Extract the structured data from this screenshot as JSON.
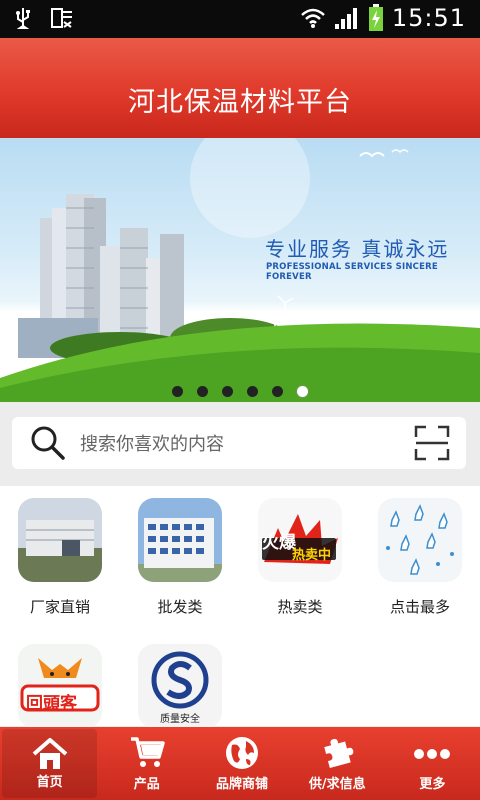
{
  "status": {
    "time": "15:51"
  },
  "header": {
    "title": "河北保温材料平台"
  },
  "banner": {
    "slogan": "专业服务  真诚永远",
    "slogan_en": "PROFESSIONAL SERVICES SINCERE FOREVER",
    "slides": 6,
    "active_slide": 6
  },
  "search": {
    "placeholder": "搜索你喜欢的内容"
  },
  "grid": {
    "items": [
      {
        "label": "厂家直销",
        "icon": "factory-image"
      },
      {
        "label": "批发类",
        "icon": "building-image"
      },
      {
        "label": "热卖类",
        "icon": "hot-sale-image",
        "badge_line1": "火爆",
        "badge_line2": "热卖中"
      },
      {
        "label": "点击最多",
        "icon": "hand-clicks-image"
      },
      {
        "label": "",
        "icon": "returning-customer-image",
        "badge": "回頭客"
      },
      {
        "label": "",
        "icon": "quality-safety-image",
        "badge": "质量安全"
      }
    ]
  },
  "nav": {
    "items": [
      {
        "label": "首页",
        "icon": "home-icon",
        "active": true
      },
      {
        "label": "产品",
        "icon": "cart-icon"
      },
      {
        "label": "品牌商铺",
        "icon": "globe-icon"
      },
      {
        "label": "供/求信息",
        "icon": "puzzle-icon"
      },
      {
        "label": "更多",
        "icon": "more-icon"
      }
    ]
  },
  "colors": {
    "header_red": "#e03a2b",
    "nav_red": "#d93324",
    "slogan_blue": "#1f5bb3"
  }
}
